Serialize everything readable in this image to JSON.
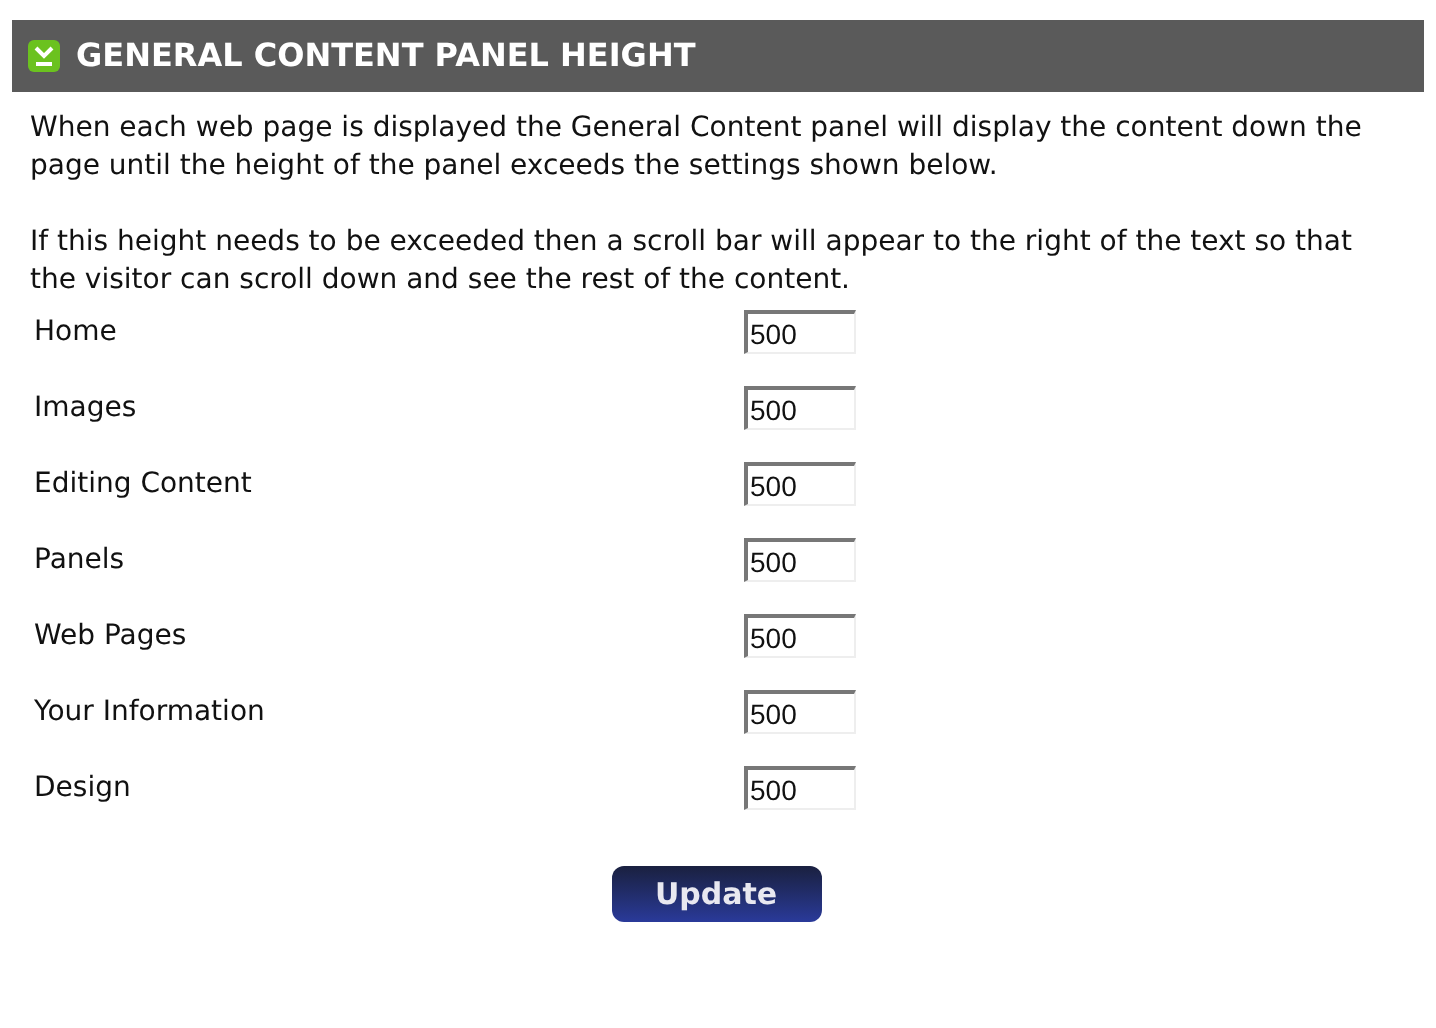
{
  "header": {
    "title": "GENERAL CONTENT PANEL HEIGHT"
  },
  "paragraphs": [
    "When each web page is displayed the General Content panel will display the content down the page until the height of the panel exceeds the settings shown below.",
    "If this height needs to be exceeded then a scroll bar will appear to the right of the text so that the visitor can scroll down and see the rest of the content."
  ],
  "fields": [
    {
      "label": "Home",
      "value": "500"
    },
    {
      "label": "Images",
      "value": "500"
    },
    {
      "label": "Editing Content",
      "value": "500"
    },
    {
      "label": "Panels",
      "value": "500"
    },
    {
      "label": "Web Pages",
      "value": "500"
    },
    {
      "label": "Your Information",
      "value": "500"
    },
    {
      "label": "Design",
      "value": "500"
    }
  ],
  "button": "Update"
}
